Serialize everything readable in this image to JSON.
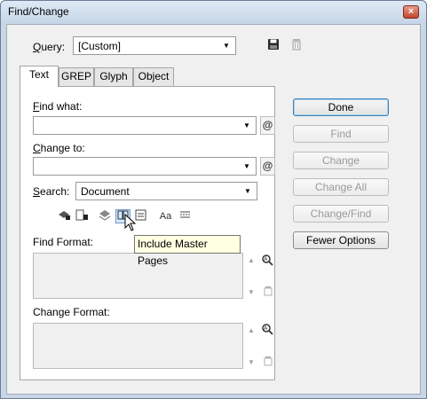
{
  "window": {
    "title": "Find/Change",
    "close_symbol": "×"
  },
  "query": {
    "label_prefix": "",
    "label_u": "Q",
    "label_rest": "uery:",
    "value": "[Custom]",
    "save_icon": "floppy-disk-icon",
    "delete_icon": "trash-icon"
  },
  "tabs": [
    {
      "label": "Text",
      "active": true
    },
    {
      "label": "GREP",
      "active": false
    },
    {
      "label": "Glyph",
      "active": false
    },
    {
      "label": "Object",
      "active": false
    }
  ],
  "find_what": {
    "label_u": "F",
    "label_rest": "ind what:",
    "value": ""
  },
  "change_to": {
    "label_u": "C",
    "label_rest": "hange to:",
    "value": ""
  },
  "search": {
    "label_u": "S",
    "label_rest": "earch:",
    "value": "Document"
  },
  "special_char": "@",
  "options": {
    "case_sensitive_label": "Aa",
    "icons": [
      "include-locked-layers-icon",
      "include-locked-stories-icon",
      "include-hidden-layers-icon",
      "include-master-pages-icon",
      "include-footnotes-icon",
      "case-sensitive-icon",
      "whole-word-icon"
    ]
  },
  "tooltip": "Include Master Pages",
  "find_format": {
    "label": "Find Format:"
  },
  "change_format": {
    "label": "Change Format:"
  },
  "buttons": {
    "done": "Done",
    "find": "Find",
    "change": "Change",
    "change_all": "Change All",
    "change_find": "Change/Find",
    "fewer_options": "Fewer Options"
  },
  "colors": {
    "frame": "#c9d6e5",
    "client_bg": "#f0f0f0",
    "tooltip_bg": "#ffffe1",
    "disabled_text": "#9a9a9a"
  }
}
